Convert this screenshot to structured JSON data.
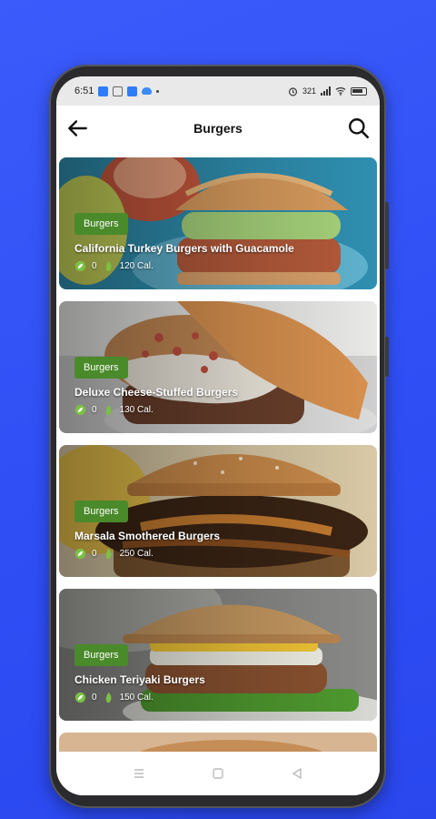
{
  "status_bar": {
    "time": "6:51",
    "network_speed": "321",
    "icons": [
      "app-notification-icon",
      "screenshot-icon",
      "bluetooth-app-icon",
      "cloud-icon",
      "alarm-icon",
      "signal-icon",
      "wifi-icon",
      "battery-icon"
    ]
  },
  "appbar": {
    "title": "Burgers",
    "back_icon": "arrow-left-icon",
    "search_icon": "search-icon"
  },
  "recipes": [
    {
      "category": "Burgers",
      "title": "California Turkey Burgers with Guacamole",
      "likes": "0",
      "calories": "120 Cal."
    },
    {
      "category": "Burgers",
      "title": "Deluxe Cheese-Stuffed Burgers",
      "likes": "0",
      "calories": "130 Cal."
    },
    {
      "category": "Burgers",
      "title": "Marsala Smothered Burgers",
      "likes": "0",
      "calories": "250 Cal."
    },
    {
      "category": "Burgers",
      "title": "Chicken Teriyaki Burgers",
      "likes": "0",
      "calories": "150 Cal."
    }
  ],
  "colors": {
    "background": "#3b5bfb",
    "badge": "#4a8a2a",
    "title_text": "#111111"
  },
  "navbar": {
    "icons": [
      "menu-icon",
      "home-square-icon",
      "back-triangle-icon"
    ]
  }
}
